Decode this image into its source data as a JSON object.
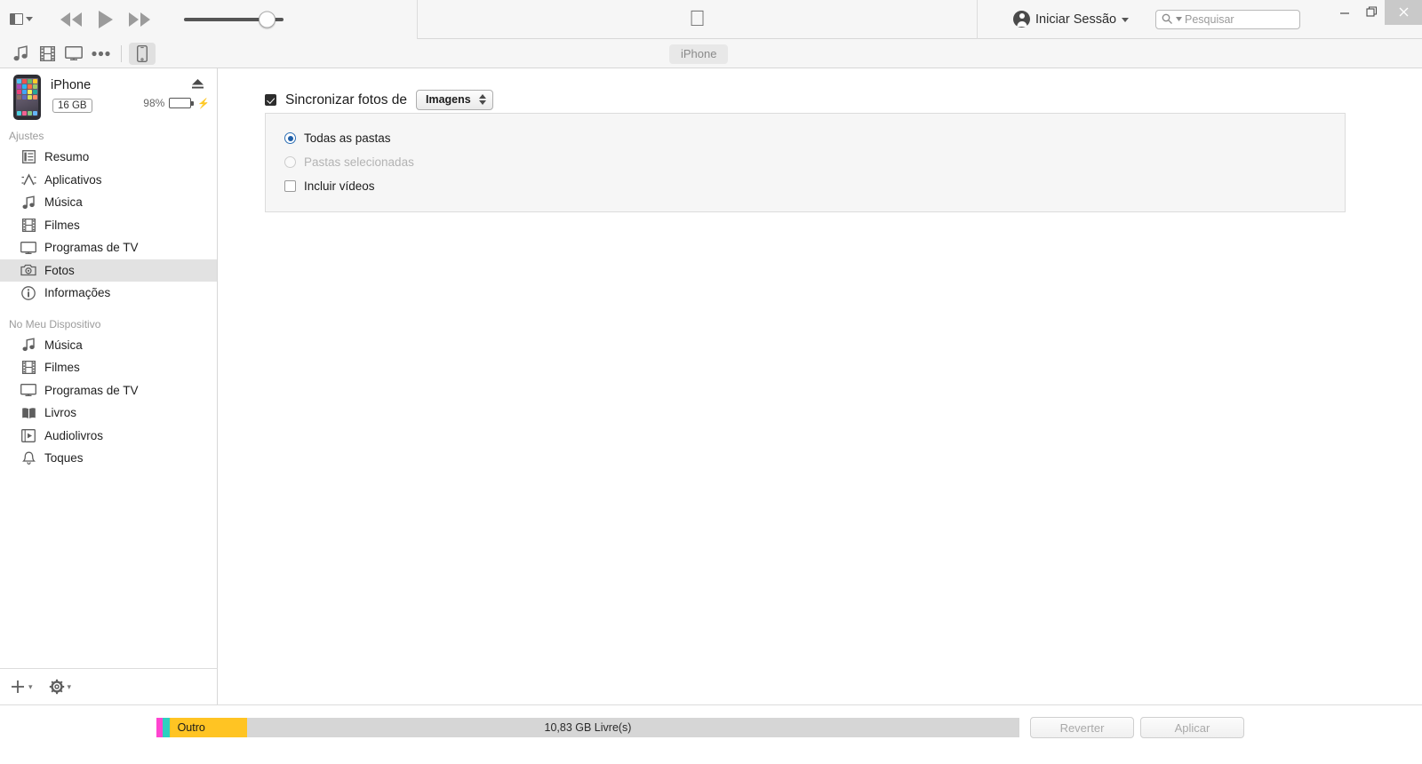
{
  "titlebar": {
    "sidebar_toggle_icon": "sidebar-toggle-icon",
    "rewind_icon": "rewind-icon",
    "play_icon": "play-icon",
    "fastforward_icon": "fast-forward-icon",
    "volume_value": 75,
    "apple_logo": "",
    "signin_label": "Iniciar Sessão",
    "search_placeholder": "Pesquisar",
    "search_value": "",
    "minimize_label": "—",
    "restore_label": "❐",
    "close_label": "✕"
  },
  "navbar": {
    "media_icons": [
      {
        "name": "music-icon",
        "label": "Música"
      },
      {
        "name": "movies-icon",
        "label": "Filmes"
      },
      {
        "name": "tv-icon",
        "label": "Programas de TV"
      },
      {
        "name": "more-icon",
        "label": "Mais"
      }
    ],
    "device_icon": "iphone-device-icon",
    "device_tab_label": "iPhone"
  },
  "sidebar": {
    "device": {
      "name": "iPhone",
      "capacity": "16 GB",
      "battery_percent": "98%",
      "battery_fill": 98,
      "charging": true,
      "eject_icon": "eject-icon"
    },
    "groups": [
      {
        "title": "Ajustes",
        "items": [
          {
            "label": "Resumo",
            "icon": "summary-icon",
            "selected": false
          },
          {
            "label": "Aplicativos",
            "icon": "apps-icon",
            "selected": false
          },
          {
            "label": "Música",
            "icon": "music-note-icon",
            "selected": false
          },
          {
            "label": "Filmes",
            "icon": "film-icon",
            "selected": false
          },
          {
            "label": "Programas de TV",
            "icon": "tv-monitor-icon",
            "selected": false
          },
          {
            "label": "Fotos",
            "icon": "camera-icon",
            "selected": true
          },
          {
            "label": "Informações",
            "icon": "info-circle-icon",
            "selected": false
          }
        ]
      },
      {
        "title": "No Meu Dispositivo",
        "items": [
          {
            "label": "Música",
            "icon": "music-note-icon",
            "selected": false
          },
          {
            "label": "Filmes",
            "icon": "film-icon",
            "selected": false
          },
          {
            "label": "Programas de TV",
            "icon": "tv-monitor-icon",
            "selected": false
          },
          {
            "label": "Livros",
            "icon": "books-icon",
            "selected": false
          },
          {
            "label": "Audiolivros",
            "icon": "audiobook-icon",
            "selected": false
          },
          {
            "label": "Toques",
            "icon": "bell-icon",
            "selected": false
          }
        ]
      }
    ],
    "footer": {
      "add_icon": "plus-icon",
      "settings_icon": "gear-icon"
    }
  },
  "main": {
    "sync_checkbox_checked": true,
    "sync_label": "Sincronizar fotos de",
    "source_popup_value": "Imagens",
    "options": [
      {
        "label": "Todas as pastas",
        "type": "radio",
        "state": "on",
        "disabled": false
      },
      {
        "label": "Pastas selecionadas",
        "type": "radio",
        "state": "off",
        "disabled": true
      },
      {
        "label": "Incluir vídeos",
        "type": "checkbox",
        "state": "off",
        "disabled": false
      }
    ]
  },
  "bottombar": {
    "capacity_segments": [
      {
        "label": "",
        "color": "#ff45d0",
        "percent": 0.75
      },
      {
        "label": "",
        "color": "#2ecfc0",
        "percent": 0.75
      },
      {
        "label": "Outro",
        "color": "#ffc423",
        "percent": 9.0
      }
    ],
    "free_space_label": "10,83 GB Livre(s)",
    "revert_button": "Reverter",
    "apply_button": "Aplicar"
  },
  "colors": {
    "accent_blue": "#1f5fa8",
    "battery_green": "#3ddb3d",
    "other_yellow": "#ffc423",
    "photos_magenta": "#ff45d0",
    "apps_teal": "#2ecfc0",
    "selected_row": "#e2e2e2"
  }
}
